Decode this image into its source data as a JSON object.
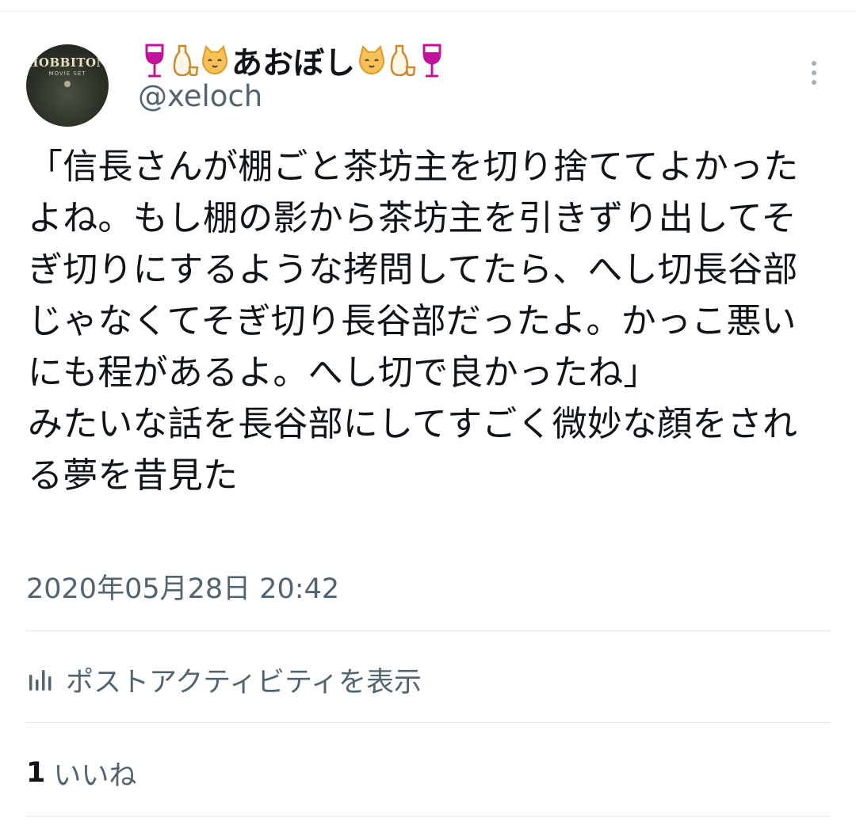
{
  "post": {
    "author": {
      "display_name": "あおぼし",
      "handle": "@xeloch",
      "avatar_text": "HOBBITON",
      "avatar_subtext": "MOVIE SET",
      "name_emojis_left": [
        "wine-glass-icon",
        "sake-bottle-icon",
        "cat-face-icon"
      ],
      "name_emojis_right": [
        "cat-face-icon",
        "sake-bottle-icon",
        "wine-glass-icon"
      ]
    },
    "text": "「信長さんが棚ごと茶坊主を切り捨ててよかったよね。もし棚の影から茶坊主を引きずり出してそぎ切りにするような拷問してたら、へし切長谷部じゃなくてそぎ切り長谷部だったよ。かっこ悪いにも程があるよ。へし切で良かったね」\nみたいな話を長谷部にしてすごく微妙な顔をされる夢を昔見た",
    "timestamp": "2020年05月28日 20:42",
    "activity_label": "ポストアクティビティを表示",
    "likes_count": "1",
    "likes_label": "いいね"
  },
  "colors": {
    "primary_text": "#0f1419",
    "secondary_text": "#536471",
    "divider": "#dfe4e8",
    "wine": "#c0139a",
    "sake": "#c98a2e",
    "cat": "#f3a23a"
  }
}
